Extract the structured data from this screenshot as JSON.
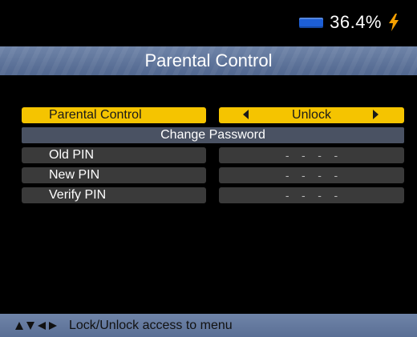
{
  "status": {
    "battery": "36.4%",
    "charging_icon": "lightning-bolt-icon",
    "battery_icon": "battery-icon"
  },
  "title": "Parental Control",
  "rows": [
    {
      "label": "Parental Control",
      "value": "Unlock",
      "selected": true
    },
    {
      "header": "Change Password"
    },
    {
      "label": "Old PIN",
      "value": "-    -    -    -"
    },
    {
      "label": "New PIN",
      "value": "-    -    -    -"
    },
    {
      "label": "Verify PIN",
      "value": "-    -    -    -"
    }
  ],
  "footer": {
    "help": "Lock/Unlock access to menu",
    "nav_icons": [
      "arrow-up-icon",
      "arrow-down-icon",
      "arrow-left-icon",
      "arrow-right-icon"
    ]
  },
  "colors": {
    "accent": "#f5c400",
    "title_bar": "#5f7499",
    "row_bg": "#3a3a3a",
    "header_row": "#4a5263",
    "battery": "#1d5fd6",
    "bolt": "#f5a000"
  }
}
